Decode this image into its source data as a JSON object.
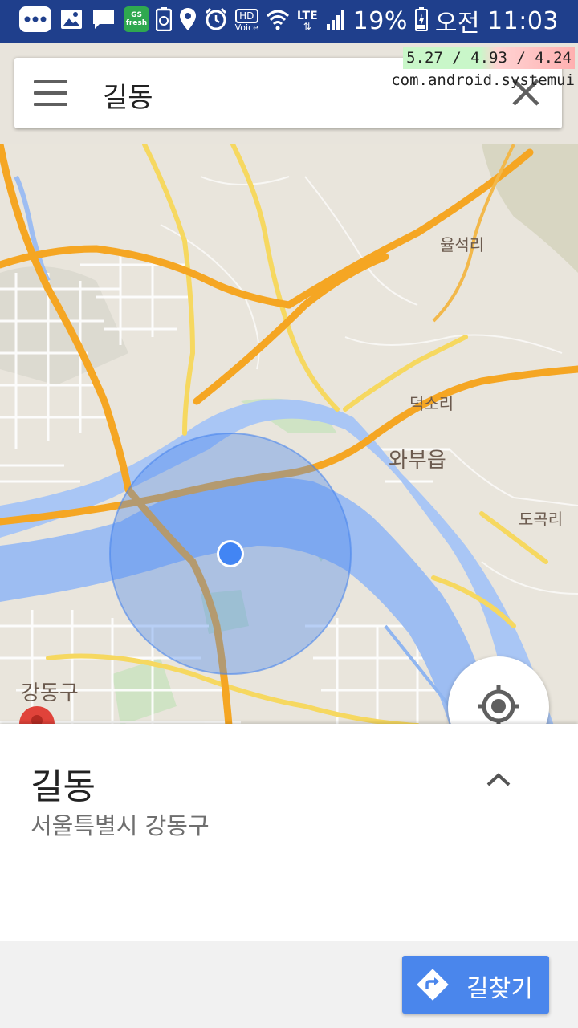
{
  "status_bar": {
    "battery_percent": "19%",
    "ampm": "오전",
    "time": "11:03",
    "network": "LTE",
    "hd_label": "HD",
    "hd_sub": "Voice",
    "gs_label": "GS fresh",
    "icons": [
      "more-icon",
      "gallery-icon",
      "message-icon",
      "gs-fresh-icon",
      "battery-saver-icon",
      "location-icon",
      "alarm-icon",
      "hd-voice-icon",
      "wifi-icon",
      "lte-icon",
      "signal-icon",
      "battery-icon"
    ]
  },
  "debug_overlay": {
    "load_avg": "5.27 / 4.93 / 4.24",
    "process": "com.android.systemui"
  },
  "search": {
    "query": "길동"
  },
  "map": {
    "labels": {
      "ulseok": "율석리",
      "deokso": "덕소리",
      "wabu": "와부읍",
      "dogok": "도곡리",
      "gangdong": "강동구"
    },
    "colors": {
      "river": "#8fb5f0",
      "highway": "#f5a623",
      "road": "#f6d860",
      "accuracy_circle": "#4a86ec",
      "location_dot": "#4285f4"
    }
  },
  "place": {
    "name": "길동",
    "address": "서울특별시 강동구"
  },
  "actions": {
    "directions_label": "길찾기"
  }
}
